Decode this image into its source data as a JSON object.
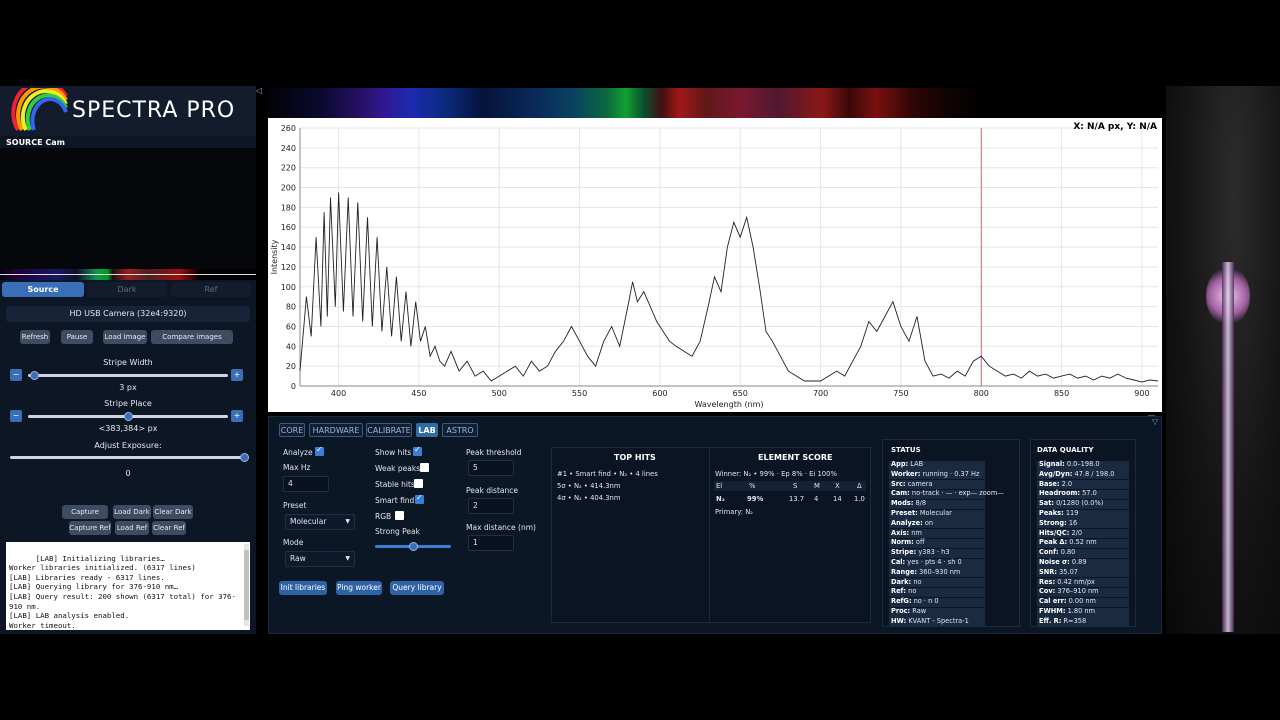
{
  "app": {
    "logo_text": "SPECTRA PRO",
    "source_label": "SOURCE Cam",
    "collapse_glyph": "◁"
  },
  "left": {
    "tabs": [
      "Source",
      "Dark",
      "Ref"
    ],
    "camera": "HD USB Camera (32e4:9320)",
    "buttons": [
      "Refresh",
      "Pause",
      "Load Image",
      "Compare images"
    ],
    "stripe_width_label": "Stripe Width",
    "stripe_width_value": "3 px",
    "stripe_width_level": 0.03,
    "stripe_place_label": "Stripe Place",
    "stripe_place_value": "<383,384> px",
    "stripe_place_level": 0.5,
    "exposure_label": "Adjust Exposure:",
    "exposure_value": "0",
    "exposure_level": 1.0,
    "calib_buttons_1": [
      "Capture Dark",
      "Load Dark",
      "Clear Dark"
    ],
    "calib_buttons_2": [
      "Capture Ref",
      "Load Ref",
      "Clear Ref"
    ],
    "console": "[LAB] Initializing libraries…\nWorker libraries initialized. (6317 lines)\n[LAB] Libraries ready - 6317 lines.\n[LAB] Querying library for 376-910 nm…\n[LAB] Query result: 200 shown (6317 total) for 376-910 nm.\n[LAB] LAB analysis enabled.\nWorker timeout."
  },
  "chart": {
    "readout": "X: N/A px, Y: N/A",
    "corner_icon": "chevron-down-icon",
    "corner_glyph": "▽"
  },
  "chart_data": {
    "type": "line",
    "xlabel": "Wavelength (nm)",
    "ylabel": "Intensity",
    "xlim": [
      376,
      910
    ],
    "ylim": [
      0,
      260
    ],
    "xticks": [
      400,
      450,
      500,
      550,
      600,
      650,
      700,
      750,
      800,
      850,
      900
    ],
    "yticks": [
      0,
      20,
      40,
      60,
      80,
      100,
      120,
      140,
      160,
      180,
      200,
      220,
      240,
      260
    ],
    "grid": true,
    "x": [
      376,
      380,
      383,
      386,
      389,
      391,
      393,
      395,
      398,
      400,
      403,
      406,
      409,
      412,
      415,
      418,
      421,
      424,
      427,
      430,
      433,
      436,
      439,
      442,
      445,
      448,
      451,
      454,
      457,
      460,
      463,
      466,
      470,
      475,
      480,
      485,
      490,
      495,
      500,
      505,
      510,
      515,
      520,
      525,
      530,
      535,
      540,
      545,
      550,
      555,
      560,
      565,
      570,
      575,
      580,
      583,
      586,
      590,
      594,
      598,
      602,
      606,
      610,
      615,
      620,
      625,
      630,
      634,
      638,
      642,
      646,
      650,
      654,
      658,
      662,
      666,
      670,
      675,
      680,
      685,
      690,
      695,
      700,
      705,
      710,
      715,
      720,
      725,
      730,
      735,
      740,
      745,
      750,
      755,
      760,
      765,
      770,
      775,
      780,
      785,
      790,
      795,
      800,
      805,
      810,
      815,
      820,
      825,
      830,
      835,
      840,
      845,
      850,
      855,
      860,
      865,
      870,
      875,
      880,
      885,
      890,
      895,
      900,
      905,
      910
    ],
    "y": [
      15,
      90,
      50,
      150,
      60,
      175,
      70,
      190,
      80,
      195,
      75,
      190,
      70,
      185,
      65,
      170,
      60,
      150,
      55,
      120,
      50,
      110,
      45,
      95,
      40,
      85,
      45,
      60,
      30,
      40,
      25,
      20,
      35,
      15,
      25,
      10,
      15,
      5,
      10,
      15,
      20,
      10,
      25,
      15,
      20,
      35,
      45,
      60,
      45,
      30,
      20,
      45,
      60,
      40,
      80,
      105,
      85,
      95,
      80,
      65,
      55,
      45,
      40,
      35,
      30,
      45,
      80,
      110,
      95,
      140,
      165,
      150,
      170,
      140,
      100,
      55,
      45,
      30,
      15,
      10,
      5,
      5,
      5,
      10,
      15,
      10,
      25,
      40,
      65,
      55,
      70,
      85,
      60,
      45,
      70,
      25,
      10,
      12,
      8,
      15,
      10,
      25,
      30,
      20,
      15,
      10,
      12,
      8,
      15,
      10,
      12,
      8,
      10,
      12,
      8,
      10,
      6,
      10,
      8,
      12,
      8,
      6,
      4,
      6,
      5
    ]
  },
  "bottom": {
    "tabs": [
      "CORE",
      "HARDWARE",
      "CALIBRATE",
      "LAB",
      "ASTRO"
    ],
    "analyze_label": "Analyze",
    "analyze_on": true,
    "max_hz_label": "Max Hz",
    "max_hz": "4",
    "preset_label": "Preset",
    "preset": "Molecular",
    "mode_label": "Mode",
    "mode": "Raw",
    "show_hits_label": "Show hits",
    "weak_peaks_label": "Weak peaks",
    "stable_hits_label": "Stable hits",
    "smart_find_label": "Smart find",
    "rgb_label": "RGB",
    "strong_peak_label": "Strong Peak",
    "strong_peak_level": 0.5,
    "peak_threshold_label": "Peak threshold",
    "peak_threshold": "5",
    "peak_distance_label": "Peak distance",
    "peak_distance": "2",
    "max_distance_label": "Max distance (nm)",
    "max_distance": "1",
    "buttons": [
      "Init libraries",
      "Ping worker",
      "Query library"
    ],
    "top_hits_title": "TOP HITS",
    "top_hits": [
      "#1 • Smart find • N₂ • 4 lines",
      "5σ • N₂ • 414.3nm",
      "4σ • N₂ • 404.3nm"
    ],
    "element_score_title": "ELEMENT SCORE",
    "winner": "Winner: N₂ • 99% · Ep 8% · Ei 100%",
    "score_headers": [
      "El",
      "%",
      "S",
      "M",
      "X",
      "Δ"
    ],
    "score_row": [
      "N₂",
      "99%",
      "13.7",
      "4",
      "14",
      "1.0"
    ],
    "primary": "Primary: N₂",
    "status_title": "STATUS",
    "status": [
      [
        "App:",
        "LAB"
      ],
      [
        "Worker:",
        "running · 0.37 Hz"
      ],
      [
        "Src:",
        "camera"
      ],
      [
        "Cam:",
        "no-track · — · exp— zoom—"
      ],
      [
        "Mods:",
        "8/8"
      ],
      [
        "Preset:",
        "Molecular"
      ],
      [
        "Analyze:",
        "on"
      ],
      [
        "Axis:",
        "nm"
      ],
      [
        "Norm:",
        "off"
      ],
      [
        "Stripe:",
        "y383 · h3"
      ],
      [
        "Cal:",
        "yes · pts 4 · sh 0"
      ],
      [
        "Range:",
        "360–930 nm"
      ],
      [
        "Dark:",
        "no"
      ],
      [
        "Ref:",
        "no"
      ],
      [
        "RefG:",
        "no · n 0"
      ],
      [
        "Proc:",
        "Raw"
      ],
      [
        "HW:",
        "KVANT - Spectra-1"
      ]
    ],
    "dq_title": "DATA QUALITY",
    "dq": [
      [
        "Signal:",
        "0.0–198.0"
      ],
      [
        "Avg/Dyn:",
        "47.8 / 198.0"
      ],
      [
        "Base:",
        "2.0"
      ],
      [
        "Headroom:",
        "57.0"
      ],
      [
        "Sat:",
        "0/1280 (0.0%)"
      ],
      [
        "Peaks:",
        "119"
      ],
      [
        "Strong:",
        "16"
      ],
      [
        "Hits/QC:",
        "2/0"
      ],
      [
        "Peak Δ:",
        "0.52 nm"
      ],
      [
        "Conf:",
        "0.80"
      ],
      [
        "Noise σ:",
        "0.89"
      ],
      [
        "SNR:",
        "35.07"
      ],
      [
        "Res:",
        "0.42 nm/px"
      ],
      [
        "Cov:",
        "376–910 nm"
      ],
      [
        "Cal err:",
        "0.00 nm"
      ],
      [
        "FWHM:",
        "1.80 nm"
      ],
      [
        "Eff. R:",
        "R≈358"
      ]
    ],
    "corner_glyph": "▽"
  },
  "colors": {
    "accent": "#3a6fb8",
    "panel": "#0c1726",
    "tab_active": "#2e6ca6",
    "red_marker": "#c0504d"
  }
}
